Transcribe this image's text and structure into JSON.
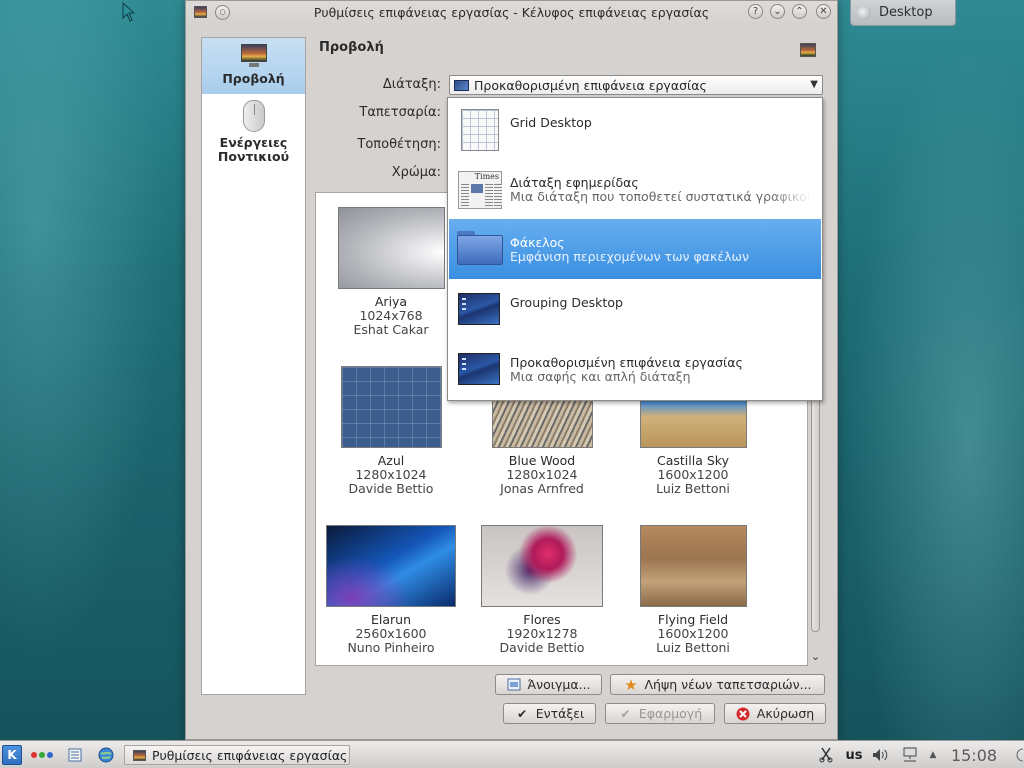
{
  "window": {
    "title": "Ρυθμίσεις επιφάνειας εργασίας - Κέλυφος επιφάνειας εργασίας",
    "buttons": {
      "help": "?",
      "minimize": "⌄",
      "maximize": "⌃",
      "close": "✕"
    }
  },
  "desktop_widget": {
    "label": "Desktop"
  },
  "sidebar": {
    "items": [
      {
        "label": "Προβολή",
        "icon": "monitor-icon",
        "selected": true
      },
      {
        "label": "Ενέργειες Ποντικιού",
        "icon": "mouse-icon",
        "selected": false
      }
    ]
  },
  "content": {
    "title": "Προβολή",
    "labels": {
      "layout": "Διάταξη:",
      "wallpaper": "Ταπετσαρία:",
      "positioning": "Τοποθέτηση:",
      "color": "Χρώμα:"
    },
    "layout_value": "Προκαθορισμένη επιφάνεια εργασίας"
  },
  "layout_options": [
    {
      "title": "Grid Desktop",
      "description": "",
      "icon": "grid-icon",
      "selected": false
    },
    {
      "title": "Διάταξη εφημερίδας",
      "description": "Μια διάταξη που τοποθετεί συστατικά γραφικού",
      "icon": "newspaper-icon",
      "selected": false,
      "icon_text": "Times"
    },
    {
      "title": "Φάκελος",
      "description": "Εμφάνιση περιεχομένων των φακέλων",
      "icon": "folder-icon",
      "selected": true
    },
    {
      "title": "Grouping Desktop",
      "description": "",
      "icon": "blue-desktop-icon",
      "selected": false
    },
    {
      "title": "Προκαθορισμένη επιφάνεια εργασίας",
      "description": "Μια σαφής και απλή διάταξη",
      "icon": "blue-desktop-icon",
      "selected": false
    }
  ],
  "wallpapers": [
    {
      "name": "Ariya",
      "size": "1024x768",
      "author": "Eshat Cakar"
    },
    {
      "name": "Azul",
      "size": "1280x1024",
      "author": "Davide Bettio"
    },
    {
      "name": "Blue Wood",
      "size": "1280x1024",
      "author": "Jonas Arnfred"
    },
    {
      "name": "Castilla Sky",
      "size": "1600x1200",
      "author": "Luiz Bettoni"
    },
    {
      "name": "Elarun",
      "size": "2560x1600",
      "author": "Nuno Pinheiro"
    },
    {
      "name": "Flores",
      "size": "1920x1278",
      "author": "Davide Bettio"
    },
    {
      "name": "Flying Field",
      "size": "1600x1200",
      "author": "Luiz Bettoni"
    }
  ],
  "buttons": {
    "open": "Άνοιγμα...",
    "get_new": "Λήψη νέων ταπετσαριών...",
    "ok": "Εντάξει",
    "apply": "Εφαρμογή",
    "cancel": "Ακύρωση"
  },
  "taskbar": {
    "task_label": "Ρυθμίσεις επιφάνειας εργασίας",
    "keyboard_layout": "us",
    "clock": "15:08"
  },
  "colors": {
    "selection": "#3a8fe0",
    "desktop": "#1f6f78",
    "window_bg": "#d6d2d0"
  }
}
